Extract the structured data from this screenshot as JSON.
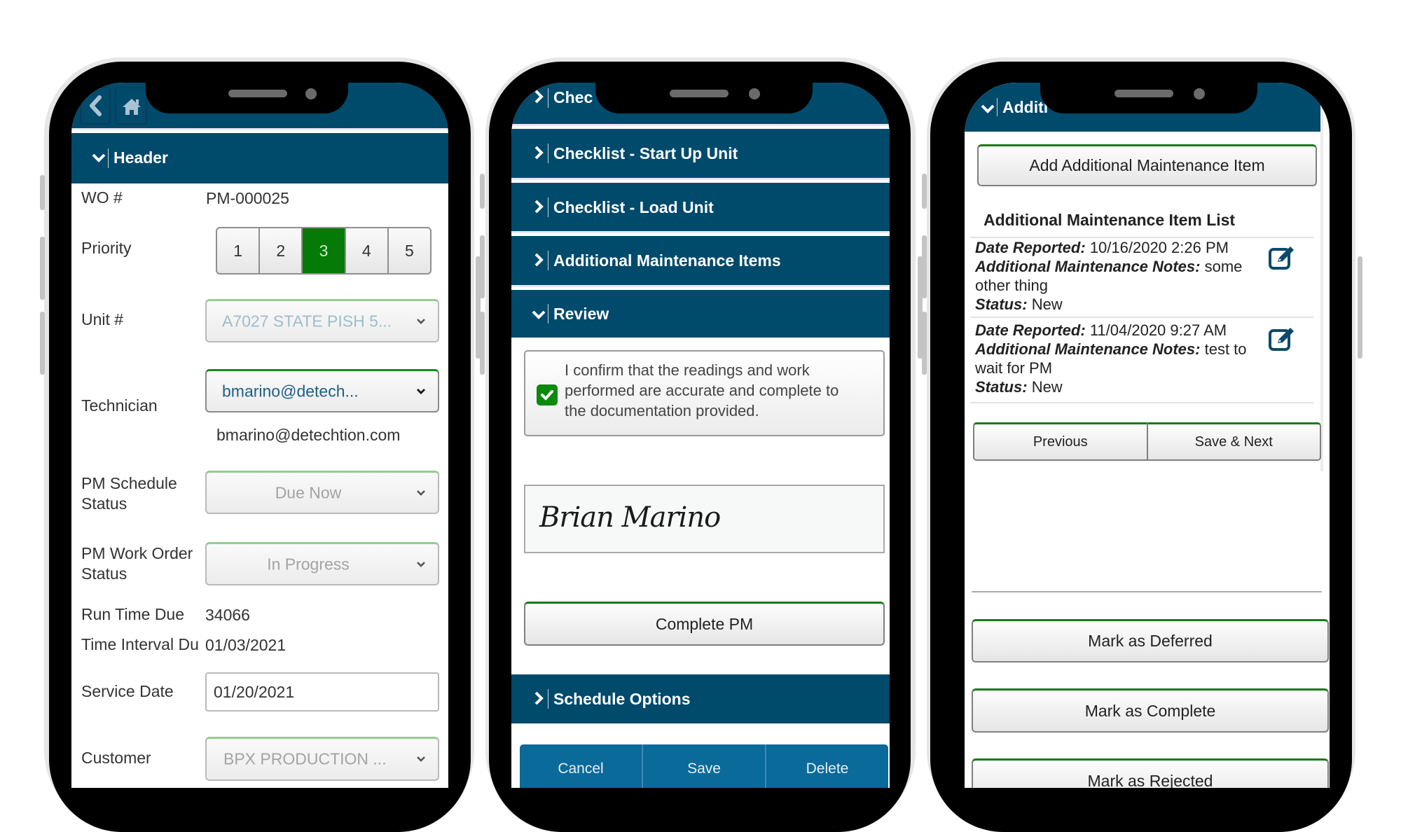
{
  "colors": {
    "primary_bar": "#004a6b",
    "accent_green": "#067a06",
    "bottom_button_blue": "#0a6a9a"
  },
  "phone1": {
    "nav": {
      "back_icon": "chevron-left-icon",
      "home_icon": "home-icon"
    },
    "section": {
      "title": "Header",
      "expanded": true
    },
    "fields": {
      "wo_label": "WO #",
      "wo_value": "PM-000025",
      "priority_label": "Priority",
      "priority_options": [
        "1",
        "2",
        "3",
        "4",
        "5"
      ],
      "priority_selected": "3",
      "unit_label": "Unit #",
      "unit_value": "A7027 STATE PISH 5...",
      "technician_label": "Technician",
      "technician_value": "bmarino@detech...",
      "technician_email": "bmarino@detechtion.com",
      "schedule_status_label_1": "PM Schedule",
      "schedule_status_label_2": "Status",
      "schedule_status_value": "Due Now",
      "wo_status_label_1": "PM Work Order",
      "wo_status_label_2": "Status",
      "wo_status_value": "In Progress",
      "run_time_label": "Run Time Due",
      "run_time_value": "34066",
      "time_interval_label": "Time Interval Du",
      "time_interval_value": "01/03/2021",
      "service_date_label": "Service Date",
      "service_date_value": "01/20/2021",
      "customer_label": "Customer",
      "customer_value": "BPX PRODUCTION ..."
    }
  },
  "phone2": {
    "sections": [
      {
        "title": "Chec",
        "expanded": false
      },
      {
        "title": "Checklist - Start Up Unit",
        "expanded": false
      },
      {
        "title": "Checklist - Load Unit",
        "expanded": false
      },
      {
        "title": "Additional Maintenance Items",
        "expanded": false
      },
      {
        "title": "Review",
        "expanded": true
      }
    ],
    "confirm": {
      "checked": true,
      "line1": "I confirm that the readings and work",
      "line2": "performed are accurate and complete to",
      "line3": "the documentation provided."
    },
    "signature": "Brian Marino",
    "complete_button": "Complete PM",
    "schedule_section": {
      "title": "Schedule Options",
      "expanded": false
    },
    "bottom_buttons": [
      "Cancel",
      "Save",
      "Delete"
    ]
  },
  "phone3": {
    "section": {
      "title": "Additi",
      "expanded": true
    },
    "add_button": "Add Additional Maintenance Item",
    "list_title": "Additional Maintenance Item List",
    "items": [
      {
        "date_label": "Date Reported:",
        "date_value": "10/16/2020 2:26 PM",
        "notes_label": "Additional Maintenance Notes:",
        "notes_value_1": "some",
        "notes_value_2": "other thing",
        "status_label": "Status:",
        "status_value": "New"
      },
      {
        "date_label": "Date Reported:",
        "date_value": "11/04/2020 9:27 AM",
        "notes_label": "Additional Maintenance Notes:",
        "notes_value_1": "test to",
        "notes_value_2": "wait for PM",
        "status_label": "Status:",
        "status_value": "New"
      }
    ],
    "previous_button": "Previous",
    "save_next_button": "Save & Next",
    "mark_buttons": [
      "Mark as Deferred",
      "Mark as Complete",
      "Mark as Rejected"
    ]
  }
}
